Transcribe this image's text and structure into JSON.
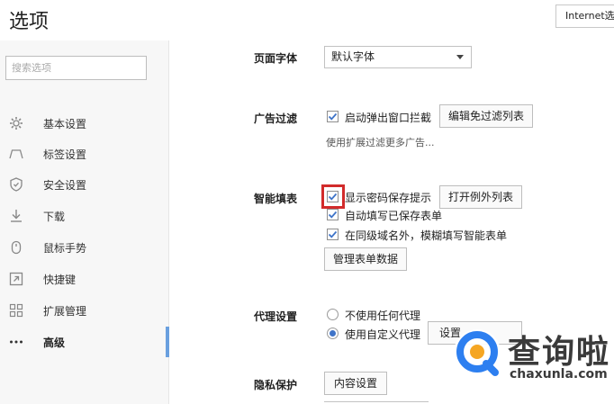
{
  "header": {
    "title": "选项",
    "top_button_label": "Internet选"
  },
  "sidebar": {
    "search_placeholder": "搜索选项",
    "items": [
      {
        "label": "基本设置",
        "icon": "gear-icon"
      },
      {
        "label": "标签设置",
        "icon": "tab-icon"
      },
      {
        "label": "安全设置",
        "icon": "shield-icon"
      },
      {
        "label": "下载",
        "icon": "download-icon"
      },
      {
        "label": "鼠标手势",
        "icon": "mouse-icon"
      },
      {
        "label": "快捷键",
        "icon": "shortcut-icon"
      },
      {
        "label": "扩展管理",
        "icon": "extensions-icon"
      },
      {
        "label": "高级",
        "icon": "more-dots-icon"
      }
    ],
    "active_index": 7
  },
  "font_section": {
    "label": "页面字体",
    "selected": "默认字体"
  },
  "ad_section": {
    "label": "广告过滤",
    "popup_block_label": "启动弹出窗口拦截",
    "popup_block_checked": true,
    "edit_filter_button": "编辑免过滤列表",
    "note": "使用扩展过滤更多广告..."
  },
  "autofill_section": {
    "label": "智能填表",
    "items": [
      {
        "label": "显示密码保存提示",
        "checked": true
      },
      {
        "label": "自动填写已保存表单",
        "checked": true
      },
      {
        "label": "在同级域名外，模糊填写智能表单",
        "checked": true
      }
    ],
    "exceptions_button": "打开例外列表",
    "manage_button": "管理表单数据"
  },
  "proxy_section": {
    "label": "代理设置",
    "options": [
      {
        "label": "不使用任何代理",
        "selected": false
      },
      {
        "label": "使用自定义代理",
        "selected": true
      }
    ],
    "settings_button": "设置"
  },
  "privacy_section": {
    "label": "隐私保护",
    "content_settings_button": "内容设置"
  },
  "watermark": {
    "name": "查询啦",
    "url": "chaxunla.com"
  },
  "colors": {
    "accent": "#6aa0df",
    "check": "#3f74c8",
    "highlight": "#d22b2b"
  }
}
